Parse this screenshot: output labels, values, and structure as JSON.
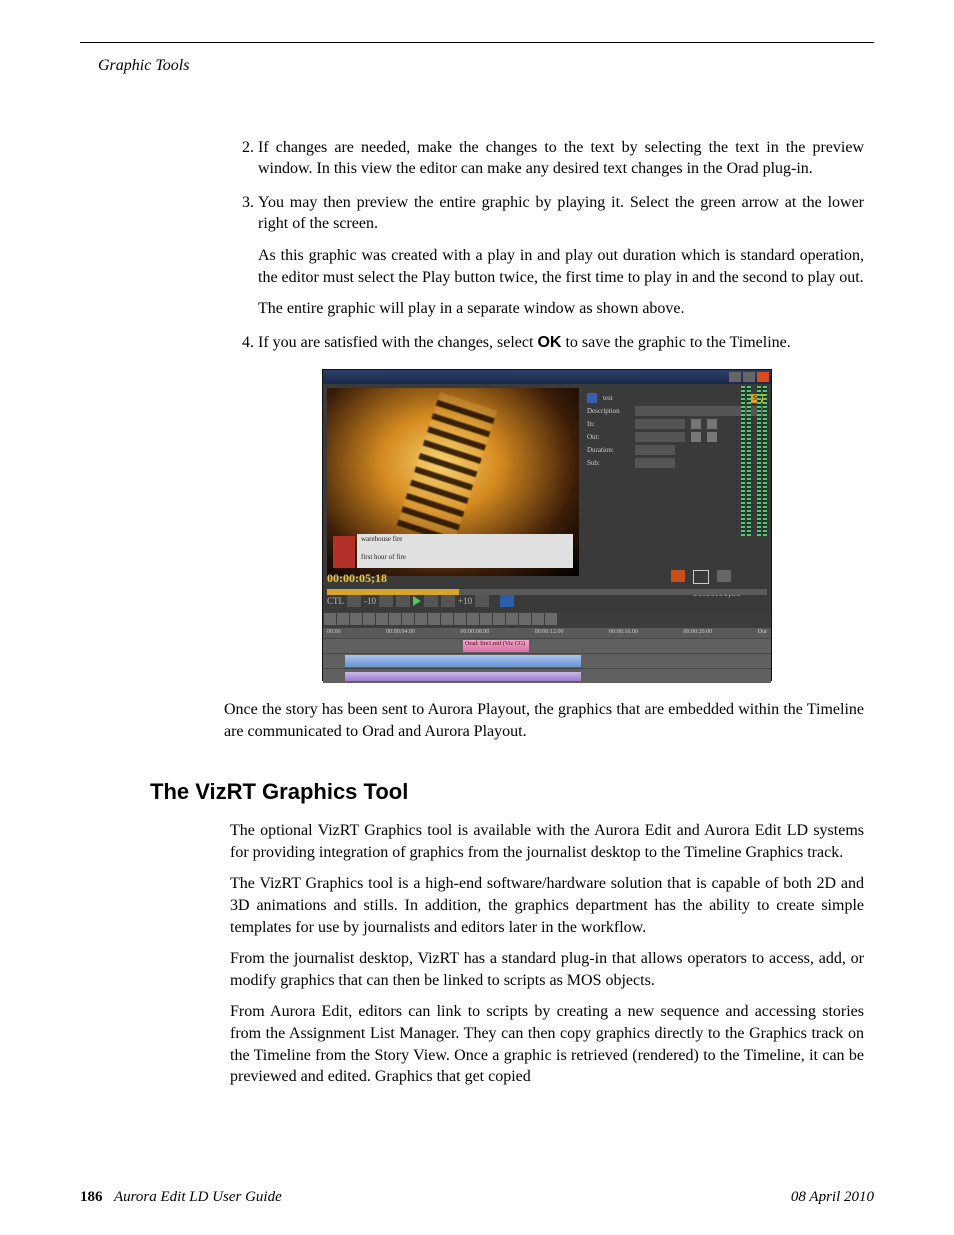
{
  "header": {
    "running_head": "Graphic Tools"
  },
  "steps": {
    "s2": "If changes are needed, make the changes to the text by selecting the text in the preview window. In this view the editor can make any desired text changes in the Orad plug-in.",
    "s3": "You may then preview the entire graphic by playing it. Select the green arrow at the lower right of the screen.",
    "s3_p1": "As this graphic was created with a play in and play out duration which is standard operation, the editor must select the Play button twice, the first time to play in and the second to play out.",
    "s3_p2": "The entire graphic will play in a separate window as shown above.",
    "s4_a": "If you are satisfied with the changes, select ",
    "s4_ok": "OK",
    "s4_b": " to save the graphic to the Timeline."
  },
  "after_figure": "Once the story has been sent to Aurora Playout, the graphics that are embedded within the Timeline are communicated to Orad and Aurora Playout.",
  "section2": {
    "title": "The VizRT Graphics Tool",
    "p1": "The optional VizRT Graphics tool is available with the Aurora Edit and Aurora Edit LD systems for providing integration of graphics from the journalist desktop to the Timeline Graphics track.",
    "p2": "The VizRT Graphics tool is a high-end software/hardware solution that is capable of both 2D and 3D animations and stills. In addition, the graphics department has the ability to create simple templates for use by journalists and editors later in the workflow.",
    "p3": "From the journalist desktop, VizRT has a standard plug-in that allows operators to access, add, or modify graphics that can then be linked to scripts as MOS objects.",
    "p4": "From Aurora Edit, editors can link to scripts by creating a new sequence and accessing stories from the Assignment List Manager. They can then copy graphics directly to the Graphics track on the Timeline from the Story View. Once a graphic is retrieved (rendered) to the Timeline, it can be previewed and edited. Graphics that get copied"
  },
  "figure": {
    "cg1": "warehouse fire",
    "cg2": "first hour of fire",
    "timecode": "00:00:05;18",
    "ctl": "CTL",
    "minus10": "-10",
    "plus10": "+10",
    "labels": {
      "test": "test",
      "description": "Description",
      "in": "In:",
      "out": "Out:",
      "duration": "Duration:",
      "sub": "Sub:",
      "sd": "SD"
    },
    "clip_g": "Orad: fire1.mif (Viz CG)",
    "tc2": "00:00:01;00",
    "ruler": [
      "00:00",
      "00:00:04.00",
      "00:00:08.00",
      "00:00:12.00",
      "00:00:16.00",
      "00:00:20.00",
      "Dur"
    ]
  },
  "footer": {
    "page": "186",
    "title": "Aurora Edit LD User Guide",
    "date": "08 April 2010"
  }
}
